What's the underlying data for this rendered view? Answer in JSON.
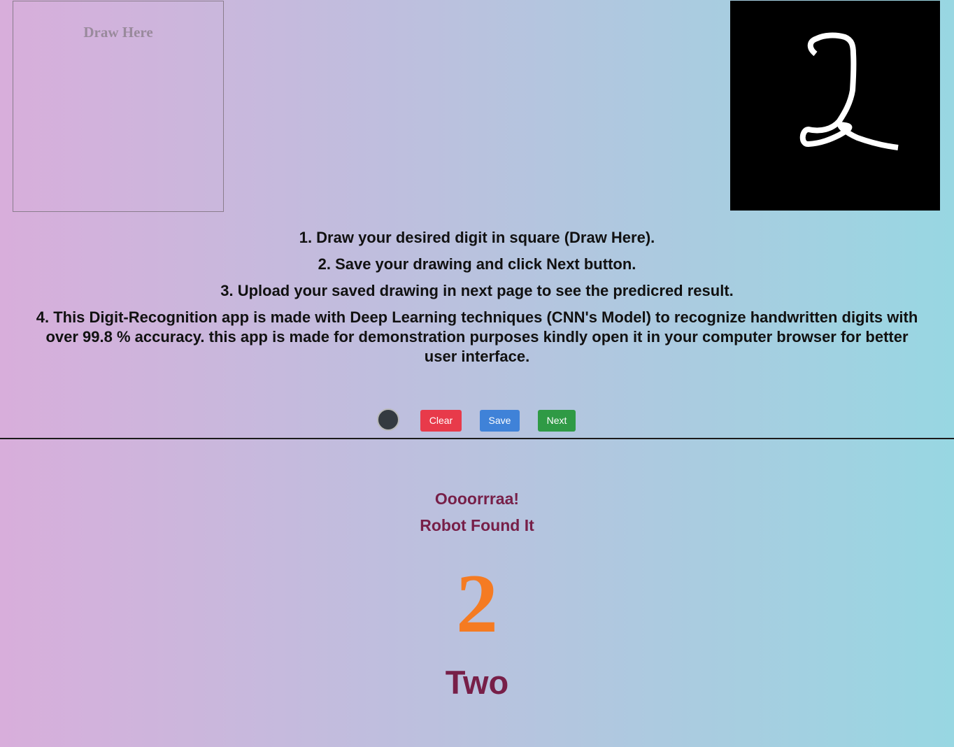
{
  "canvas": {
    "draw_label": "Draw Here"
  },
  "instructions": [
    "1. Draw your desired digit in square (Draw Here).",
    "2. Save your drawing and click Next button.",
    "3. Upload your saved drawing in next page to see the predicred result.",
    "4. This Digit-Recognition app is made with Deep Learning techniques (CNN's Model) to recognize handwritten digits with over 99.8 % accuracy. this app is made for demonstration purposes kindly open it in your computer browser for better user interface."
  ],
  "controls": {
    "color_picker_value": "#343a40",
    "clear_label": "Clear",
    "save_label": "Save",
    "next_label": "Next"
  },
  "result": {
    "line1": "Oooorrraa!",
    "line2": "Robot Found It",
    "digit": "2",
    "word": "Two"
  },
  "colors": {
    "clear": "#e83a4a",
    "save": "#3f82d8",
    "next": "#2f9a45",
    "result_text": "#771f48",
    "result_digit": "#f57b22"
  }
}
